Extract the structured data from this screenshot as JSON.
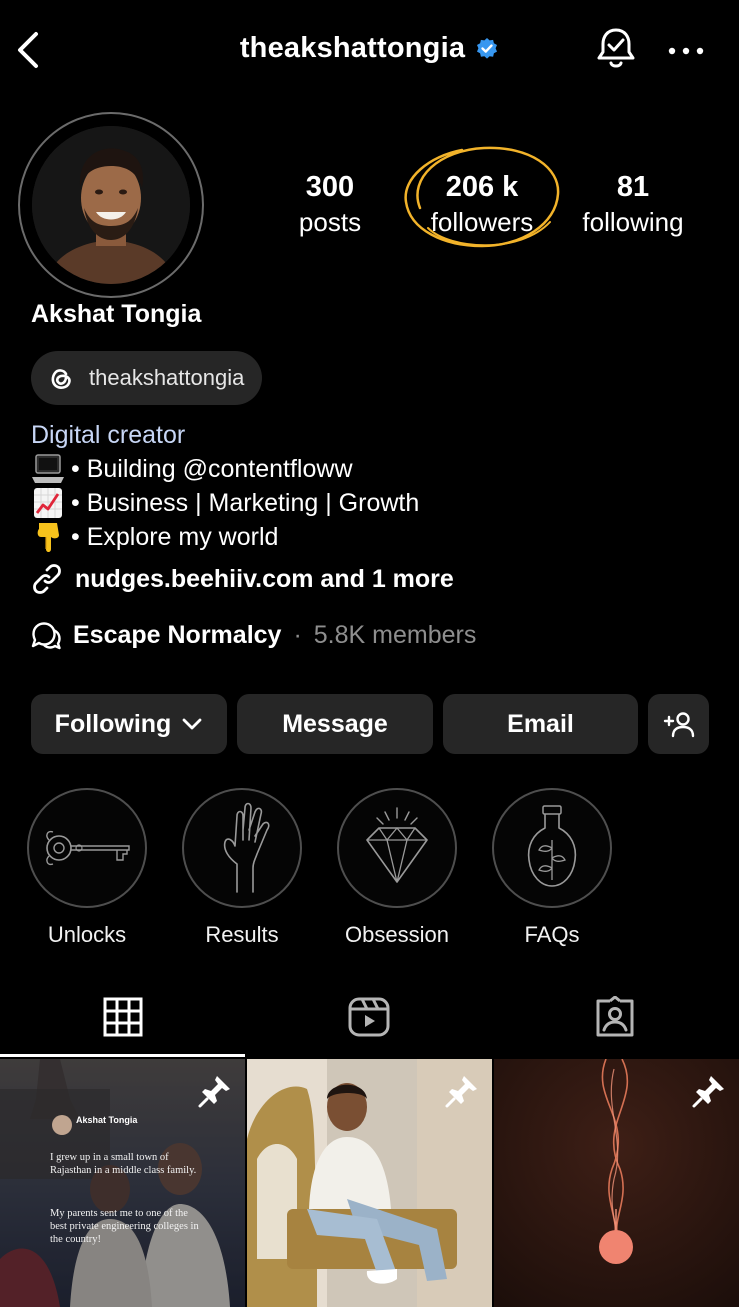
{
  "header": {
    "username": "theakshattongia",
    "back_icon": "chevron-left-icon",
    "verified_icon": "verified-badge-icon",
    "notify_icon": "bell-check-icon",
    "more_icon": "more-horizontal-icon"
  },
  "stats": {
    "posts_value": "300",
    "posts_label": "posts",
    "followers_value": "206 k",
    "followers_label": "followers",
    "following_value": "81",
    "following_label": "following"
  },
  "profile": {
    "name": "Akshat Tongia",
    "threads_handle": "theakshattongia",
    "category": "Digital creator",
    "bio_lines": [
      "• Building @contentfloww",
      "• Business | Marketing | Growth",
      "• Explore my world"
    ],
    "link_text": "nudges.beehiiv.com and 1 more",
    "community_name": "Escape Normalcy",
    "community_separator": "·",
    "community_members": "5.8K members"
  },
  "actions": {
    "following_label": "Following",
    "message_label": "Message",
    "email_label": "Email",
    "add_person_icon": "add-person-icon"
  },
  "highlights": [
    {
      "label": "Unlocks",
      "icon": "key-icon"
    },
    {
      "label": "Results",
      "icon": "hand-icon"
    },
    {
      "label": "Obsession",
      "icon": "diamond-icon"
    },
    {
      "label": "FAQs",
      "icon": "potion-bottle-icon"
    }
  ],
  "tabs": [
    {
      "name": "grid",
      "icon": "grid-icon",
      "selected": true
    },
    {
      "name": "reels",
      "icon": "reels-icon",
      "selected": false
    },
    {
      "name": "tagged",
      "icon": "tagged-icon",
      "selected": false
    }
  ],
  "posts": [
    {
      "pinned": true,
      "author": "Akshat Tongia",
      "text_1": "I grew up in a small town of Rajasthan in a middle class family.",
      "text_2": "My parents sent me to one of the best private engineering colleges in the country!"
    },
    {
      "pinned": true
    },
    {
      "pinned": true
    }
  ],
  "colors": {
    "background": "#000000",
    "button": "#262626",
    "category_text": "#c7d6f5",
    "verified": "#3797f0",
    "highlight_circle": "#f2b32a"
  }
}
